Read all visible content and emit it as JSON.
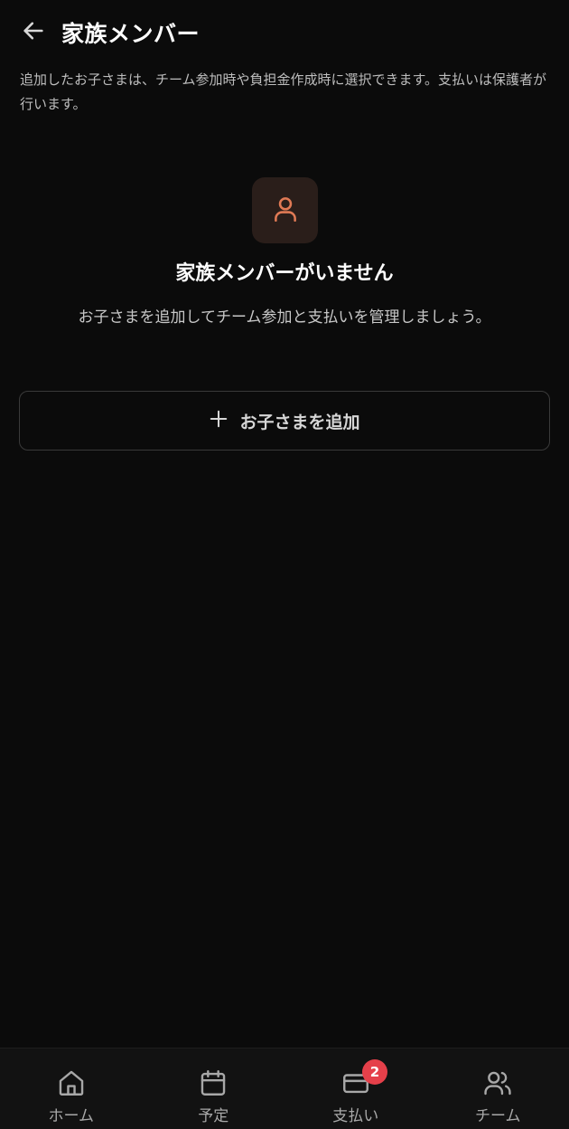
{
  "header": {
    "title": "家族メンバー",
    "back_icon": "arrow-left-icon"
  },
  "description": "追加したお子さまは、チーム参加時や負担金作成時に選択できます。支払いは保護者が行います。",
  "empty_state": {
    "icon": "user-icon",
    "title": "家族メンバーがいません",
    "subtitle": "お子さまを追加してチーム参加と支払いを管理しましょう。"
  },
  "add_button": {
    "label": "お子さまを追加",
    "icon": "plus-icon"
  },
  "bottom_nav": {
    "items": [
      {
        "label": "ホーム",
        "icon": "home-icon"
      },
      {
        "label": "予定",
        "icon": "calendar-icon"
      },
      {
        "label": "支払い",
        "icon": "credit-card-icon",
        "badge": "2"
      },
      {
        "label": "チーム",
        "icon": "users-icon"
      }
    ]
  },
  "colors": {
    "background": "#0b0b0b",
    "accent": "#e07a55",
    "badge": "#e5404a"
  }
}
